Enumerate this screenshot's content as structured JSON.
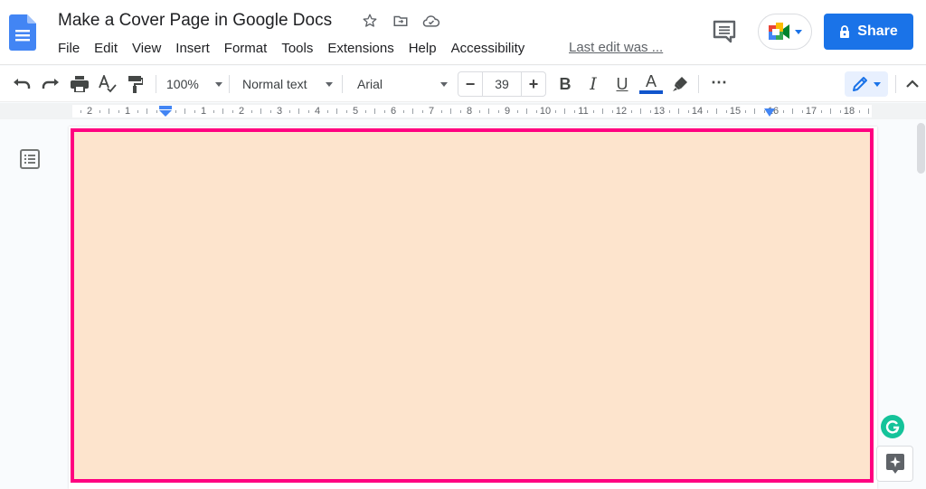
{
  "app": {
    "doc_title": "Make a Cover Page in Google Docs",
    "last_edit": "Last edit was ...",
    "share_label": "Share",
    "brand_color": "#1a73e8"
  },
  "menu": [
    "File",
    "Edit",
    "View",
    "Insert",
    "Format",
    "Tools",
    "Extensions",
    "Help",
    "Accessibility"
  ],
  "toolbar": {
    "zoom": "100%",
    "style": "Normal text",
    "font": "Arial",
    "font_size": "39",
    "minus": "−",
    "plus": "+",
    "bold": "B",
    "italic": "I",
    "underline": "U",
    "text_color_glyph": "A",
    "text_color": "#1155cc",
    "more": "⋯"
  },
  "ruler": {
    "labels": [
      "2",
      "1",
      "1",
      "2",
      "3",
      "4",
      "5",
      "6",
      "7",
      "8",
      "9",
      "10",
      "11",
      "12",
      "13",
      "14",
      "15",
      "16",
      "17",
      "18"
    ]
  },
  "page": {
    "fill_color": "#fde4cd",
    "border_color": "#ff0080"
  },
  "icons": {
    "star": "star-icon",
    "move": "move-to-folder-icon",
    "cloud": "cloud-saved-icon"
  }
}
